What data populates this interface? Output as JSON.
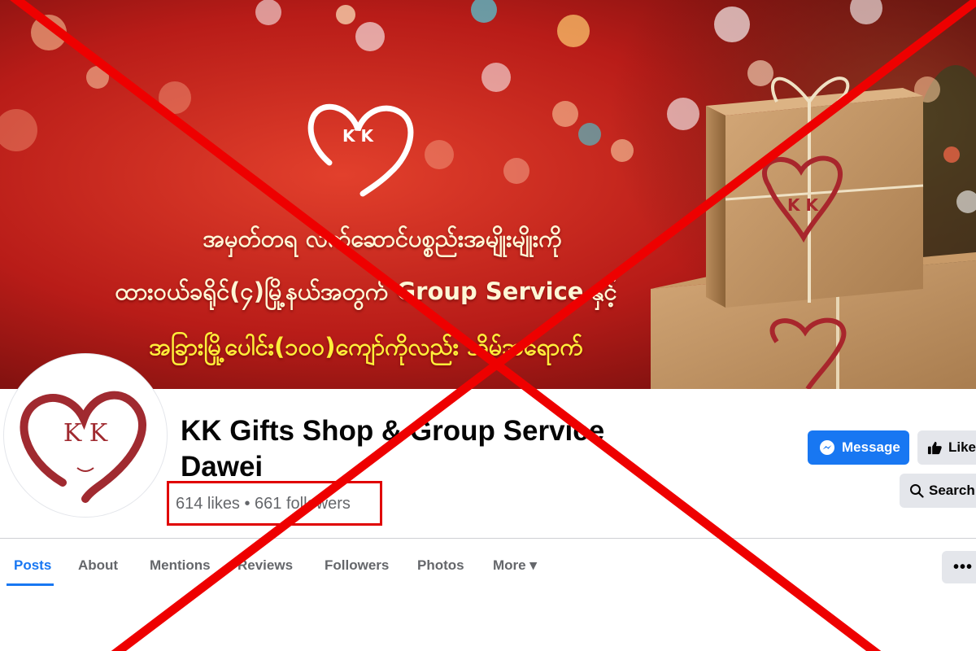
{
  "cover": {
    "logo_text": "K K",
    "lines": [
      "အမှတ်တရ လက်ဆောင်ပစ္စည်းအမျိုးမျိုးကို",
      "ထားဝယ်ခရိုင်(၄)မြို့နယ်အတွက် Group Service နှင့်",
      "အခြားမြို့ပေါင်း(၁၀၀)ကျော်ကိုလည်း အိမ်အရောက်"
    ],
    "box_logo_text": "K K"
  },
  "avatar": {
    "logo_text": "K K"
  },
  "page": {
    "name": "KK Gifts Shop & Group Service Dawei",
    "stats": "614 likes • 661 followers"
  },
  "actions": {
    "message_label": "Message",
    "like_label": "Like",
    "search_label": "Search",
    "more_label": "•••"
  },
  "tabs": [
    {
      "label": "Posts",
      "active": true
    },
    {
      "label": "About"
    },
    {
      "label": "Mentions"
    },
    {
      "label": "Reviews"
    },
    {
      "label": "Followers"
    },
    {
      "label": "Photos"
    },
    {
      "label": "More ▾"
    }
  ],
  "colors": {
    "brand_blue": "#1877f2",
    "cross_red": "#ee0000",
    "logo_maroon": "#a02a30",
    "cover_red": "#c0201c"
  },
  "icons": [
    "messenger-icon",
    "thumbs-up-icon",
    "search-icon",
    "heart-logo-icon",
    "cross-out-mark"
  ]
}
